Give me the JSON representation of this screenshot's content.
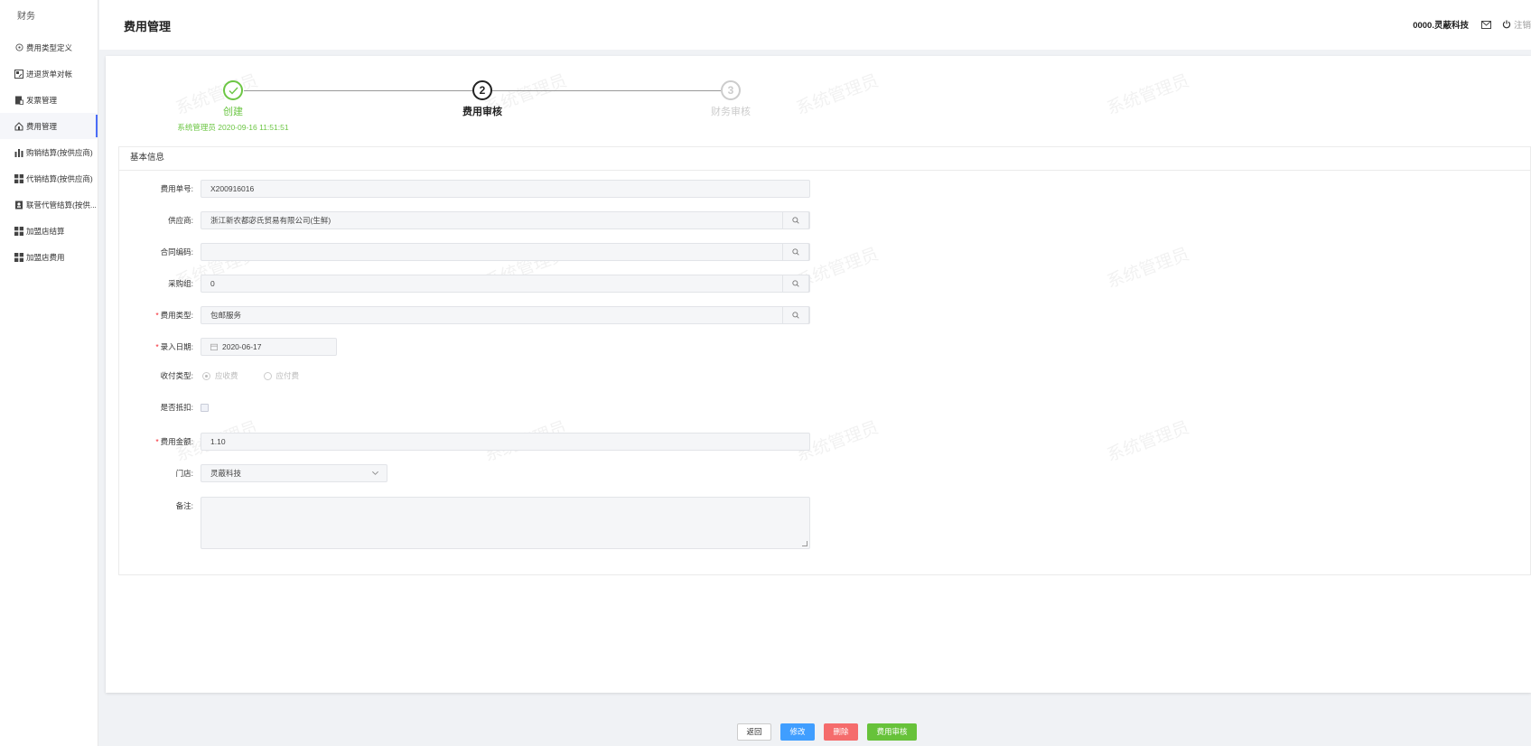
{
  "sidebar": {
    "heading": "财务",
    "items": [
      {
        "label": "费用类型定义",
        "icon": "circle-dot-icon"
      },
      {
        "label": "进退货单对帐",
        "icon": "image-frame-icon"
      },
      {
        "label": "发票管理",
        "icon": "invoice-icon"
      },
      {
        "label": "费用管理",
        "icon": "home-icon"
      },
      {
        "label": "购销结算(按供应商)",
        "icon": "bar-chart-icon"
      },
      {
        "label": "代销结算(按供应商)",
        "icon": "grid-icon"
      },
      {
        "label": "联营代管结算(按供...",
        "icon": "contact-book-icon"
      },
      {
        "label": "加盟店结算",
        "icon": "grid-icon"
      },
      {
        "label": "加盟店费用",
        "icon": "grid-icon"
      }
    ],
    "active_index": 3
  },
  "header": {
    "title": "费用管理",
    "company": "0000.灵蔽科技",
    "logout_label": "注销"
  },
  "steps": [
    {
      "num": "1",
      "title": "创建",
      "desc": "系统管理员 2020-09-16 11:51:51",
      "status": "done"
    },
    {
      "num": "2",
      "title": "费用审核",
      "desc": "",
      "status": "current"
    },
    {
      "num": "3",
      "title": "财务审核",
      "desc": "",
      "status": "wait"
    }
  ],
  "watermark": "系统管理员",
  "form": {
    "section_title": "基本信息",
    "fee_no_label": "费用单号:",
    "fee_no": "X200916016",
    "supplier_label": "供应商:",
    "supplier": "浙江新农都宓氏贸易有限公司(生鲜)",
    "contract_label": "合同编码:",
    "contract": "",
    "purchase_group_label": "采购组:",
    "purchase_group": "0",
    "fee_type_label": "费用类型:",
    "fee_type": "包邮服务",
    "entry_date_label": "录入日期:",
    "entry_date": "2020-06-17",
    "pay_type_label": "收付类型:",
    "pay_type_options": [
      "应收费",
      "应付费"
    ],
    "pay_type_selected": 0,
    "deduct_label": "是否抵扣:",
    "deduct_checked": false,
    "amount_label": "费用金额:",
    "amount": "1.10",
    "store_label": "门店:",
    "store": "灵蔽科技",
    "remark_label": "备注:",
    "remark": ""
  },
  "actions": {
    "back": "返回",
    "edit": "修改",
    "delete": "删除",
    "audit": "费用审核"
  },
  "colors": {
    "accent": "#4a6cf7",
    "done": "#6cc644",
    "edit": "#409eff",
    "delete": "#f56c6c",
    "audit": "#67c23a"
  }
}
